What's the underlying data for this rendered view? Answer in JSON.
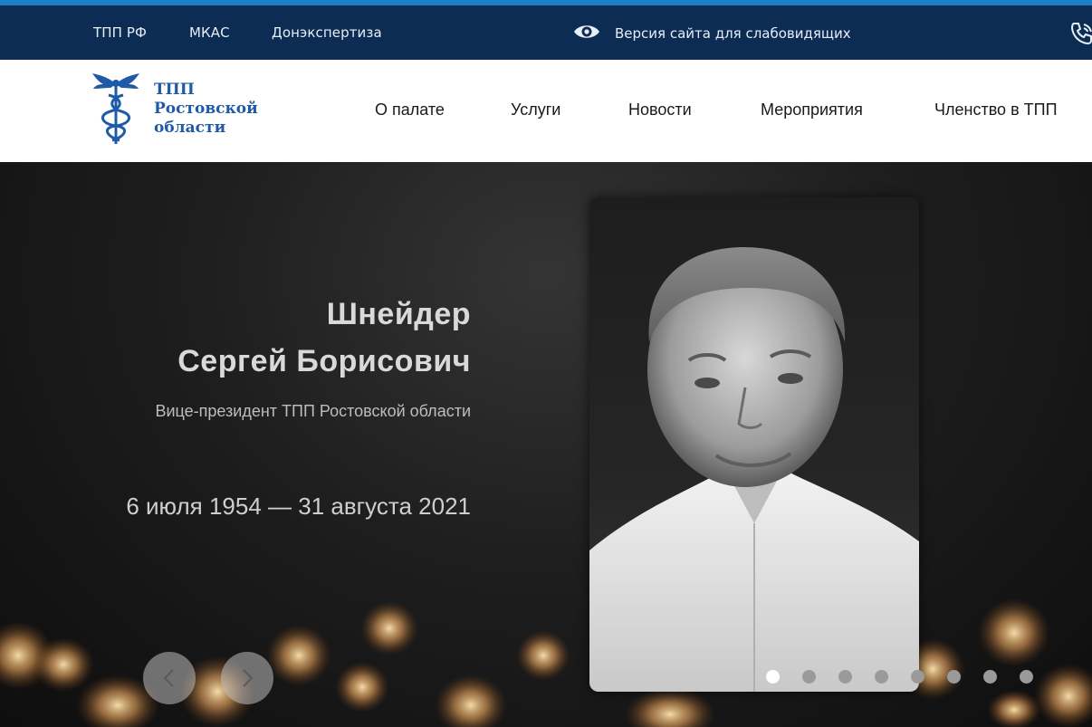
{
  "topbar": {
    "links": [
      "ТПП РФ",
      "МКАС",
      "Донэкспертиза"
    ],
    "vision_label": "Версия сайта для слабовидящих",
    "vision_icon": "eye-icon",
    "phone_icon": "phone-icon"
  },
  "header": {
    "logo_lines": [
      "ТПП",
      "Ростовской",
      "области"
    ],
    "nav": [
      "О палате",
      "Услуги",
      "Новости",
      "Мероприятия",
      "Членство в ТПП"
    ]
  },
  "hero": {
    "name_line1": "Шнейдер",
    "name_line2": "Сергей Борисович",
    "role": "Вице-президент ТПП Ростовской области",
    "dates": "6 июля 1954 — 31 августа 2021",
    "prev_icon": "chevron-left-icon",
    "next_icon": "chevron-right-icon",
    "slide_count": 8,
    "active_slide": 1
  },
  "colors": {
    "topbar_bg": "#0d2c54",
    "accent": "#1f7fc6",
    "logo_blue": "#1f5aa6"
  }
}
